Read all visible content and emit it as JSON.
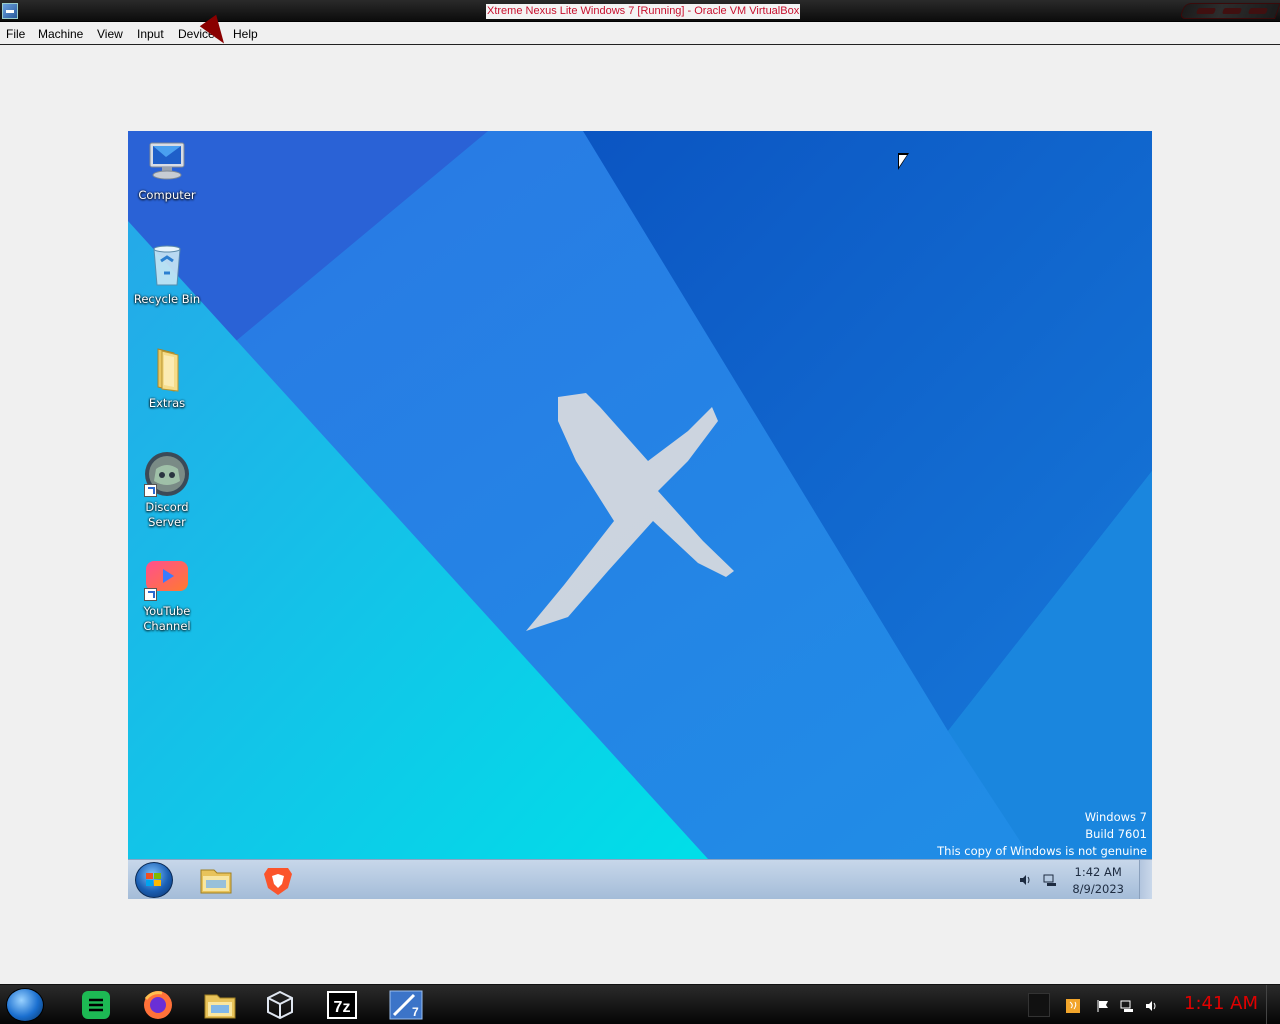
{
  "window": {
    "title": "Xtreme Nexus Lite Windows 7 [Running] - Oracle VM VirtualBox",
    "app_icon": "virtualbox-icon"
  },
  "menu": {
    "items": [
      "File",
      "Machine",
      "View",
      "Input",
      "Devices",
      "Help"
    ]
  },
  "guest": {
    "desktop_icons": [
      {
        "label": "Computer",
        "icon": "computer-icon",
        "shortcut": false
      },
      {
        "label": "Recycle Bin",
        "icon": "recycle-bin-icon",
        "shortcut": false
      },
      {
        "label": "Extras",
        "icon": "folder-icon",
        "shortcut": false
      },
      {
        "label": "Discord\nServer",
        "icon": "discord-icon",
        "shortcut": true
      },
      {
        "label": "YouTube\nChannel",
        "icon": "youtube-icon",
        "shortcut": true
      }
    ],
    "wallpaper_logo": "x-logo",
    "watermark": {
      "line1": "Windows 7",
      "line2": "Build 7601",
      "line3": "This copy of Windows is not genuine"
    },
    "taskbar": {
      "pinned": [
        "start-orb",
        "file-explorer-icon",
        "brave-browser-icon"
      ],
      "tray_icons": [
        "volume-icon",
        "network-icon"
      ],
      "time": "1:42 AM",
      "date": "8/9/2023"
    },
    "colors": {
      "wallpaper_cyan": "#00d6e6",
      "wallpaper_blue": "#1b6fd9",
      "wallpaper_deep": "#0d57c6",
      "taskbar": "#b3c8e2"
    }
  },
  "host_taskbar": {
    "pinned": [
      "start-orb",
      "spotify-icon",
      "firefox-icon",
      "file-explorer-icon",
      "virtualbox-icon",
      "7zip-icon",
      "windows7-tool-icon"
    ],
    "tray_icons": [
      "java-icon",
      "flag-icon",
      "network-icon",
      "volume-icon"
    ],
    "time": "1:41 AM",
    "time_color": "#e00000"
  }
}
